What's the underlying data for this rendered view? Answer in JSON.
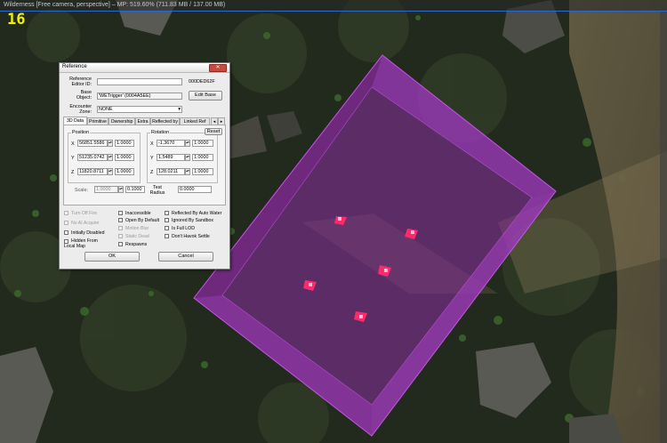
{
  "fps_counter": "16",
  "window_title": "Wilderness [Free camera, perspective] – MP: 519.60% (711.83 MB / 137.00 MB)",
  "dialog": {
    "title": "Reference",
    "close_glyph": "✕",
    "editor_id_label": "Reference Editor ID:",
    "editor_id_value": "",
    "form_id": "000DED62F",
    "base_object_label": "Base Object:",
    "base_object_value": "'WETrigger' (0004A5EE)",
    "edit_base_label": "Edit Base",
    "encounter_zone_label": "Encounter Zone:",
    "encounter_zone_value": "NONE",
    "tabs": [
      "3D Data",
      "Primitive",
      "Ownership",
      "Extra",
      "Reflected by",
      "Linked Ref"
    ],
    "tab_prev": "◂",
    "tab_next": "▸",
    "position_label": "Position",
    "rotation_label": "Rotation",
    "reset_label": "Reset",
    "axes": [
      "X",
      "Y",
      "Z"
    ],
    "position": [
      "56851.5586",
      "51235.0742",
      "11820.8711"
    ],
    "position_step": [
      "1.0000",
      "1.0000",
      "1.0000"
    ],
    "rotation": [
      "-1.3670",
      "1.5489",
      "128.0211"
    ],
    "rotation_step": [
      "1.0000",
      "1.0000",
      "1.0000"
    ],
    "scale_label": "Scale:",
    "scale_value": "1.0000",
    "scale_step": "0.1000",
    "test_radius_label": "Test Radius",
    "test_radius_value": "0.0000",
    "checkboxes": [
      {
        "label": "Turn Off Fire",
        "enabled": false
      },
      {
        "label": "No AI Acquire",
        "enabled": false
      },
      {
        "label": "Initially Disabled",
        "enabled": true
      },
      {
        "label": "Hidden From Local Map",
        "enabled": true
      },
      {
        "label": "Inaccessible",
        "enabled": true
      },
      {
        "label": "Open By Default",
        "enabled": true
      },
      {
        "label": "Motion Blur",
        "enabled": false
      },
      {
        "label": "Static Dead",
        "enabled": false
      },
      {
        "label": "Respawns",
        "enabled": true
      },
      {
        "label": "Reflected By Auto Water",
        "enabled": true
      },
      {
        "label": "Ignored By Sandbox",
        "enabled": true
      },
      {
        "label": "Is Full LOD",
        "enabled": true
      },
      {
        "label": "Don't Havok Settle",
        "enabled": true
      }
    ],
    "ok_label": "OK",
    "cancel_label": "Cancel"
  },
  "colors": {
    "trigger_fill": "#8a2ea0",
    "trigger_edge": "#b03fd0",
    "marker": "#ff2a6a",
    "fps": "#f1f000"
  },
  "scene_markers": 5
}
